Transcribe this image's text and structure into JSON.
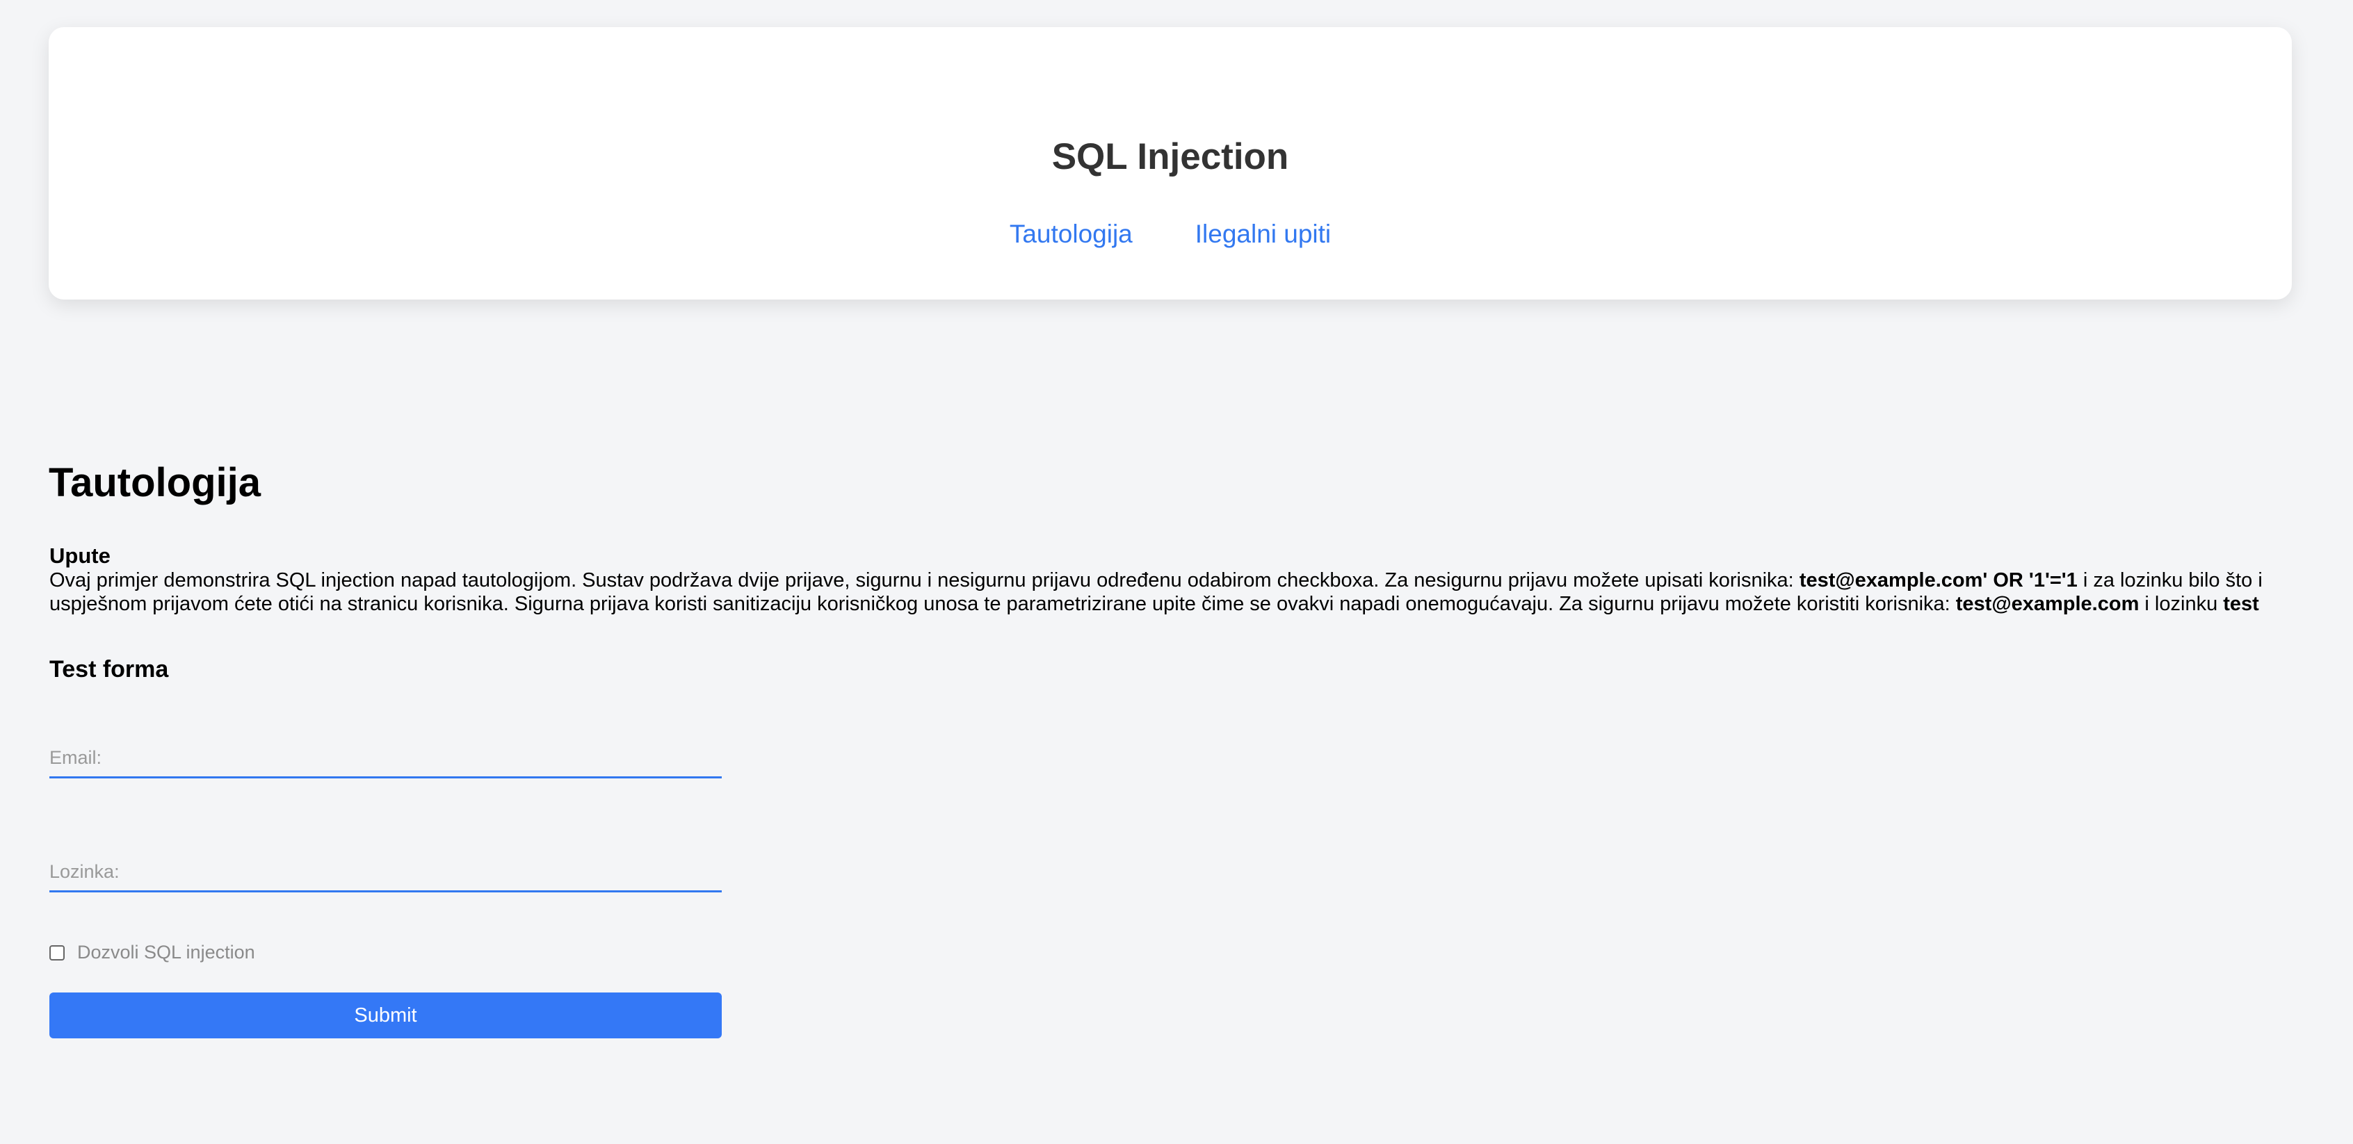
{
  "header": {
    "title": "SQL Injection",
    "nav": [
      {
        "label": "Tautologija"
      },
      {
        "label": "Ilegalni upiti"
      }
    ]
  },
  "main": {
    "section_title": "Tautologija",
    "instructions": {
      "label": "Upute",
      "line1_part1": "Ovaj primjer demonstrira SQL injection napad tautologijom. Sustav podržava dvije prijave, sigurnu i nesigurnu prijavu određenu odabirom checkboxa. Za nesigurnu prijavu možete upisati korisnika: ",
      "unsafe_user": "test@example.com' OR '1'='1",
      "line1_part2": " i za lozinku bilo što i",
      "line2_part1": "uspješnom prijavom ćete otići na stranicu korisnika. Sigurna prijava koristi sanitizaciju korisničkog unosa te parametrizirane upite čime se ovakvi napadi onemogućavaju. Za sigurnu prijavu možete koristiti korisnika: ",
      "safe_user": "test@example.com",
      "line2_part2": " i lozinku ",
      "safe_password": "test"
    },
    "form": {
      "title": "Test forma",
      "email_placeholder": "Email:",
      "password_placeholder": "Lozinka:",
      "checkbox_label": "Dozvoli SQL injection",
      "submit_label": "Submit"
    }
  },
  "colors": {
    "accent": "#3278f0",
    "button": "#3478f6",
    "background": "#f4f5f7"
  }
}
